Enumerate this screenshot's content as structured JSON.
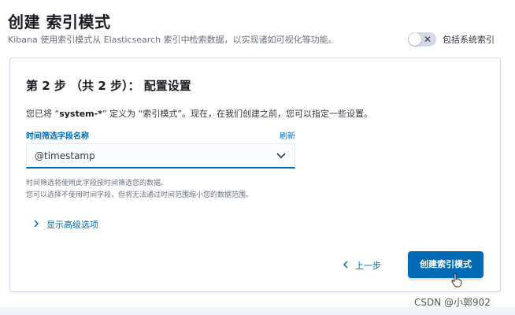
{
  "header": {
    "title": "创建 索引模式",
    "subtitle": "Kibana 使用索引模式从 Elasticsearch 索引中检索数据，以实现诸如可视化等功能。",
    "system_toggle": {
      "label": "包括系统索引",
      "state": "off",
      "icon_glyph": "✕"
    }
  },
  "step": {
    "title": "第 2 步 （共 2 步）： 配置设置",
    "desc_prefix": "您已将 “",
    "desc_pattern": "system-*",
    "desc_suffix": "” 定义为 “索引模式”。现在，在我们创建之前，您可以指定一些设置。"
  },
  "time_field": {
    "label": "时间筛选字段名称",
    "refresh_label": "刷新",
    "selected_value": "@timestamp",
    "help_line_1": "时间筛选将使用此字段按时间筛选您的数据。",
    "help_line_2": "您可以选择不使用时间字段，但将无法通过时间范围缩小您的数据范围。"
  },
  "advanced": {
    "label": "显示高级选项"
  },
  "actions": {
    "back_label": "上一步",
    "create_label": "创建索引模式"
  },
  "watermark": "CSDN @小郭902",
  "colors": {
    "primary": "#006bb4",
    "title": "#1a1c21",
    "subdued": "#69707d",
    "border": "#d3dae6"
  },
  "icons": {
    "toggle": "close-icon",
    "select": "chevron-down-icon",
    "advanced": "chevron-right-icon",
    "back": "chevron-left-icon",
    "pointer": "hand-cursor-icon"
  }
}
